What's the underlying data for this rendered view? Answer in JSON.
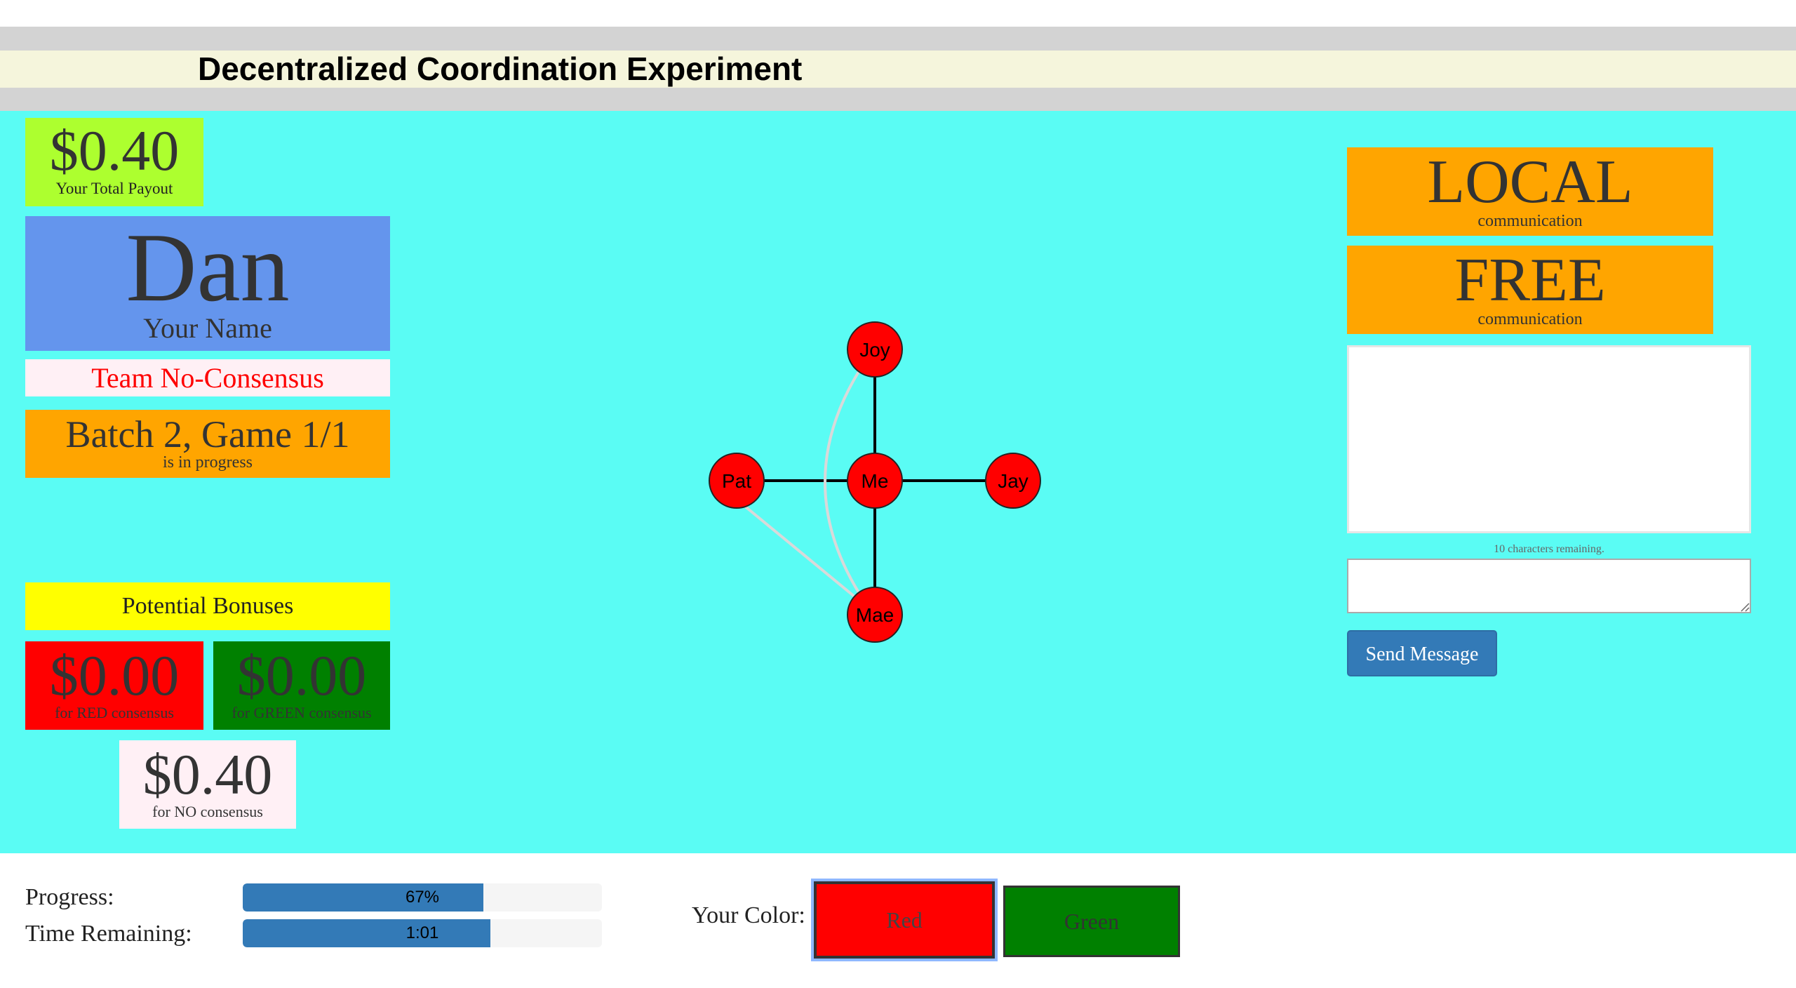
{
  "header": {
    "title": "Decentralized Coordination Experiment"
  },
  "payout": {
    "amount": "$0.40",
    "label": "Your Total Payout"
  },
  "player": {
    "name": "Dan",
    "name_label": "Your Name",
    "team": "Team No-Consensus"
  },
  "status": {
    "batch_game": "Batch 2, Game 1/1",
    "state": "is in progress"
  },
  "bonuses": {
    "title": "Potential Bonuses",
    "red": {
      "amount": "$0.00",
      "label": "for RED consensus"
    },
    "green": {
      "amount": "$0.00",
      "label": "for GREEN consensus"
    },
    "none": {
      "amount": "$0.40",
      "label": "for NO consensus"
    }
  },
  "network": {
    "node_color": "#ff0000",
    "nodes": [
      {
        "id": "joy",
        "label": "Joy"
      },
      {
        "id": "pat",
        "label": "Pat"
      },
      {
        "id": "me",
        "label": "Me"
      },
      {
        "id": "jay",
        "label": "Jay"
      },
      {
        "id": "mae",
        "label": "Mae"
      }
    ],
    "edges": [
      {
        "from": "me",
        "to": "joy",
        "type": "direct"
      },
      {
        "from": "me",
        "to": "pat",
        "type": "direct"
      },
      {
        "from": "me",
        "to": "jay",
        "type": "direct"
      },
      {
        "from": "me",
        "to": "mae",
        "type": "direct"
      },
      {
        "from": "joy",
        "to": "mae",
        "type": "indirect"
      },
      {
        "from": "pat",
        "to": "mae",
        "type": "indirect"
      }
    ]
  },
  "communication": {
    "scope": {
      "value": "LOCAL",
      "label": "communication"
    },
    "mode": {
      "value": "FREE",
      "label": "communication"
    },
    "chars_remaining": "10 characters remaining.",
    "message_value": "",
    "send_label": "Send Message"
  },
  "footer": {
    "progress_label": "Progress:",
    "progress_value": 0.67,
    "progress_text": "67%",
    "time_label": "Time Remaining:",
    "time_fraction": 0.69,
    "time_text": "1:01",
    "color_label": "Your Color:",
    "red_label": "Red",
    "green_label": "Green",
    "selected_color": "Red"
  }
}
